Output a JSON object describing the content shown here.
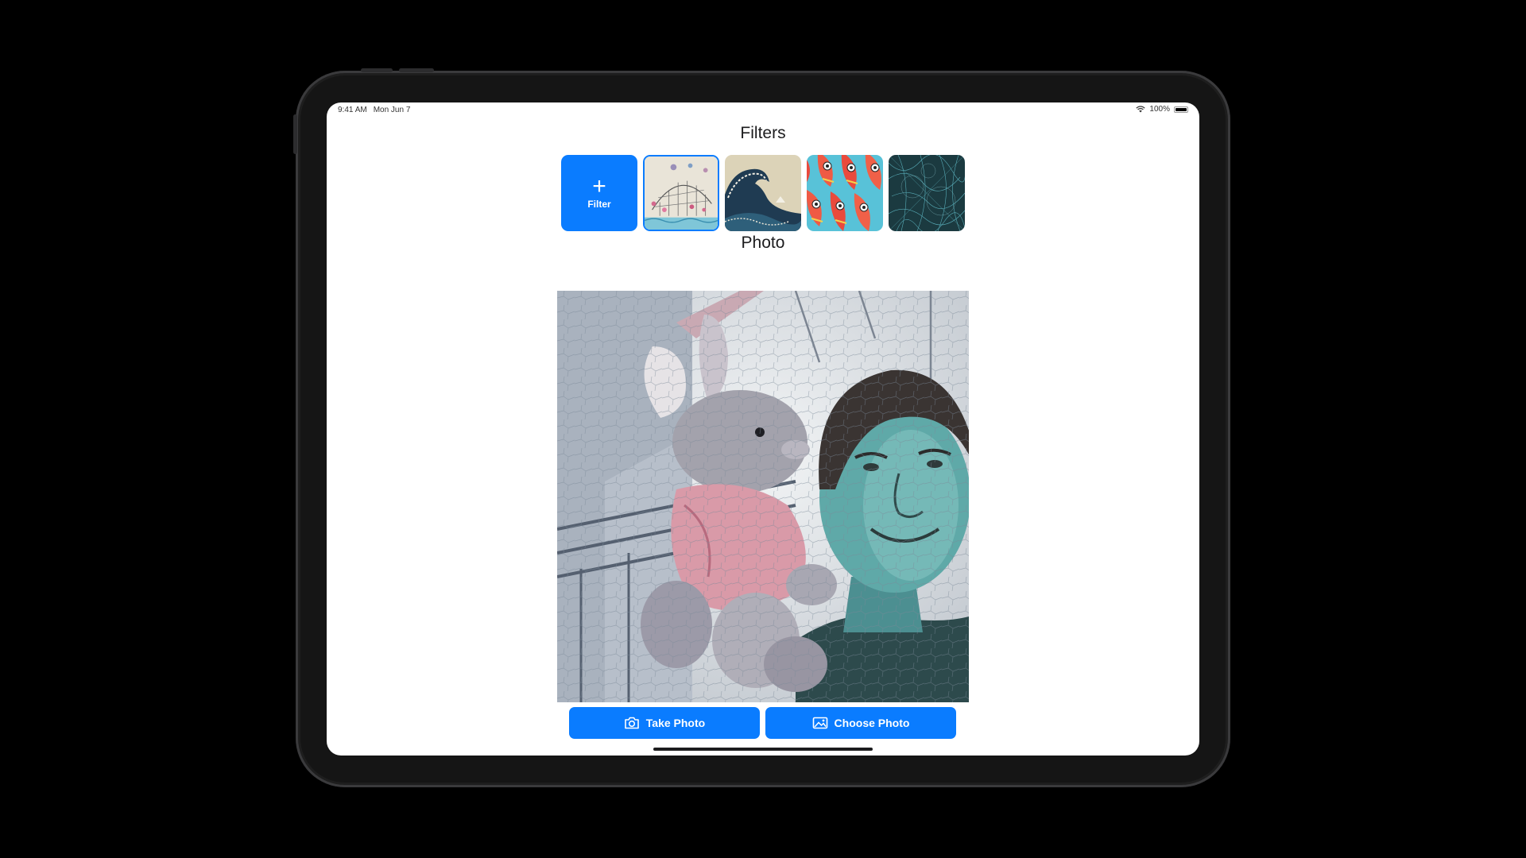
{
  "status_bar": {
    "time": "9:41 AM",
    "date": "Mon Jun 7",
    "battery": "100%",
    "battery_level": 1.0
  },
  "filters_section": {
    "title": "Filters",
    "add_filter_label": "Filter",
    "selected_index": 0,
    "thumbnails": [
      {
        "id": "sketch-bridge"
      },
      {
        "id": "great-wave"
      },
      {
        "id": "fish-pattern"
      },
      {
        "id": "teal-texture"
      }
    ]
  },
  "photo_section": {
    "title": "Photo"
  },
  "actions": {
    "take_photo_label": "Take Photo",
    "choose_photo_label": "Choose Photo"
  },
  "colors": {
    "accent": "#0a7cff",
    "background": "#000000",
    "screen": "#ffffff"
  },
  "icons": {
    "take_photo": "camera-icon",
    "choose_photo": "photo-icon",
    "add_filter": "plus-icon",
    "wifi": "wifi-icon",
    "battery": "battery-icon"
  }
}
